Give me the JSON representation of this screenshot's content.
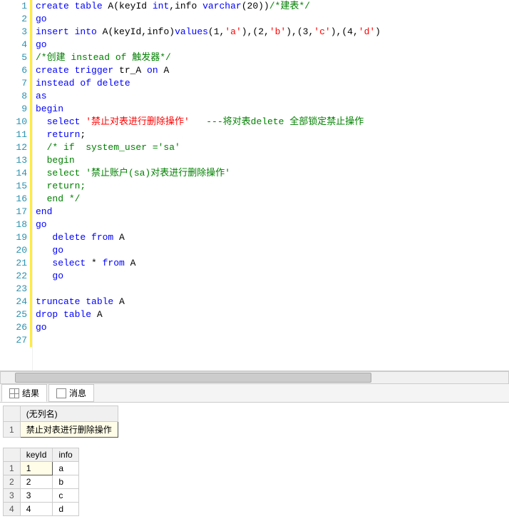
{
  "code": {
    "lines": [
      [
        {
          "t": "create table",
          "c": "kw"
        },
        {
          "t": " A",
          "c": "id"
        },
        {
          "t": "(",
          "c": "id"
        },
        {
          "t": "keyId ",
          "c": "id"
        },
        {
          "t": "int",
          "c": "kw"
        },
        {
          "t": ",",
          "c": "id"
        },
        {
          "t": "info ",
          "c": "id"
        },
        {
          "t": "varchar",
          "c": "kw"
        },
        {
          "t": "(",
          "c": "id"
        },
        {
          "t": "20",
          "c": "num"
        },
        {
          "t": "))",
          "c": "id"
        },
        {
          "t": "/*建表*/",
          "c": "com"
        }
      ],
      [
        {
          "t": "go",
          "c": "kw"
        }
      ],
      [
        {
          "t": "insert into",
          "c": "kw"
        },
        {
          "t": " A",
          "c": "id"
        },
        {
          "t": "(",
          "c": "id"
        },
        {
          "t": "keyId",
          "c": "id"
        },
        {
          "t": ",",
          "c": "id"
        },
        {
          "t": "info",
          "c": "id"
        },
        {
          "t": ")",
          "c": "id"
        },
        {
          "t": "values",
          "c": "kw"
        },
        {
          "t": "(",
          "c": "id"
        },
        {
          "t": "1",
          "c": "num"
        },
        {
          "t": ",",
          "c": "id"
        },
        {
          "t": "'a'",
          "c": "str"
        },
        {
          "t": ")",
          "c": "id"
        },
        {
          "t": ",",
          "c": "id"
        },
        {
          "t": "(",
          "c": "id"
        },
        {
          "t": "2",
          "c": "num"
        },
        {
          "t": ",",
          "c": "id"
        },
        {
          "t": "'b'",
          "c": "str"
        },
        {
          "t": ")",
          "c": "id"
        },
        {
          "t": ",",
          "c": "id"
        },
        {
          "t": "(",
          "c": "id"
        },
        {
          "t": "3",
          "c": "num"
        },
        {
          "t": ",",
          "c": "id"
        },
        {
          "t": "'c'",
          "c": "str"
        },
        {
          "t": ")",
          "c": "id"
        },
        {
          "t": ",",
          "c": "id"
        },
        {
          "t": "(",
          "c": "id"
        },
        {
          "t": "4",
          "c": "num"
        },
        {
          "t": ",",
          "c": "id"
        },
        {
          "t": "'d'",
          "c": "str"
        },
        {
          "t": ")",
          "c": "id"
        }
      ],
      [
        {
          "t": "go",
          "c": "kw"
        }
      ],
      [
        {
          "t": "/*创建 instead of 触发器*/",
          "c": "com"
        }
      ],
      [
        {
          "t": "create trigger",
          "c": "kw"
        },
        {
          "t": " tr_A ",
          "c": "id"
        },
        {
          "t": "on",
          "c": "kw"
        },
        {
          "t": " A",
          "c": "id"
        }
      ],
      [
        {
          "t": "instead of delete",
          "c": "kw"
        }
      ],
      [
        {
          "t": "as",
          "c": "kw"
        }
      ],
      [
        {
          "t": "begin",
          "c": "kw"
        }
      ],
      [
        {
          "t": "  ",
          "c": "id"
        },
        {
          "t": "select",
          "c": "kw"
        },
        {
          "t": " ",
          "c": "id"
        },
        {
          "t": "'禁止对表进行删除操作'",
          "c": "str"
        },
        {
          "t": "   ",
          "c": "id"
        },
        {
          "t": "---将对表delete 全部锁定禁止操作",
          "c": "com"
        }
      ],
      [
        {
          "t": "  ",
          "c": "id"
        },
        {
          "t": "return",
          "c": "kw"
        },
        {
          "t": ";",
          "c": "id"
        }
      ],
      [
        {
          "t": "  ",
          "c": "id"
        },
        {
          "t": "/* if  system_user ='sa'",
          "c": "com"
        }
      ],
      [
        {
          "t": "  ",
          "c": "id"
        },
        {
          "t": "begin",
          "c": "com"
        }
      ],
      [
        {
          "t": "  ",
          "c": "id"
        },
        {
          "t": "select '禁止账户(sa)对表进行删除操作'",
          "c": "com"
        }
      ],
      [
        {
          "t": "  ",
          "c": "id"
        },
        {
          "t": "return;",
          "c": "com"
        }
      ],
      [
        {
          "t": "  ",
          "c": "id"
        },
        {
          "t": "end */",
          "c": "com"
        }
      ],
      [
        {
          "t": "end",
          "c": "kw"
        }
      ],
      [
        {
          "t": "go",
          "c": "kw"
        }
      ],
      [
        {
          "t": "   ",
          "c": "id"
        },
        {
          "t": "delete from",
          "c": "kw"
        },
        {
          "t": " A",
          "c": "id"
        }
      ],
      [
        {
          "t": "   ",
          "c": "id"
        },
        {
          "t": "go",
          "c": "kw"
        }
      ],
      [
        {
          "t": "   ",
          "c": "id"
        },
        {
          "t": "select",
          "c": "kw"
        },
        {
          "t": " * ",
          "c": "id"
        },
        {
          "t": "from",
          "c": "kw"
        },
        {
          "t": " A",
          "c": "id"
        }
      ],
      [
        {
          "t": "   ",
          "c": "id"
        },
        {
          "t": "go",
          "c": "kw"
        }
      ],
      [
        {
          "t": "",
          "c": "id"
        }
      ],
      [
        {
          "t": "truncate table",
          "c": "kw"
        },
        {
          "t": " A",
          "c": "id"
        }
      ],
      [
        {
          "t": "drop table",
          "c": "kw"
        },
        {
          "t": " A",
          "c": "id"
        }
      ],
      [
        {
          "t": "go",
          "c": "kw"
        }
      ],
      [
        {
          "t": "",
          "c": "id"
        }
      ]
    ]
  },
  "tabs": {
    "results": "结果",
    "messages": "消息"
  },
  "result1": {
    "header": "(无列名)",
    "value": "禁止对表进行删除操作"
  },
  "result2": {
    "headers": [
      "keyId",
      "info"
    ],
    "rows": [
      {
        "n": "1",
        "keyId": "1",
        "info": "a"
      },
      {
        "n": "2",
        "keyId": "2",
        "info": "b"
      },
      {
        "n": "3",
        "keyId": "3",
        "info": "c"
      },
      {
        "n": "4",
        "keyId": "4",
        "info": "d"
      }
    ]
  }
}
